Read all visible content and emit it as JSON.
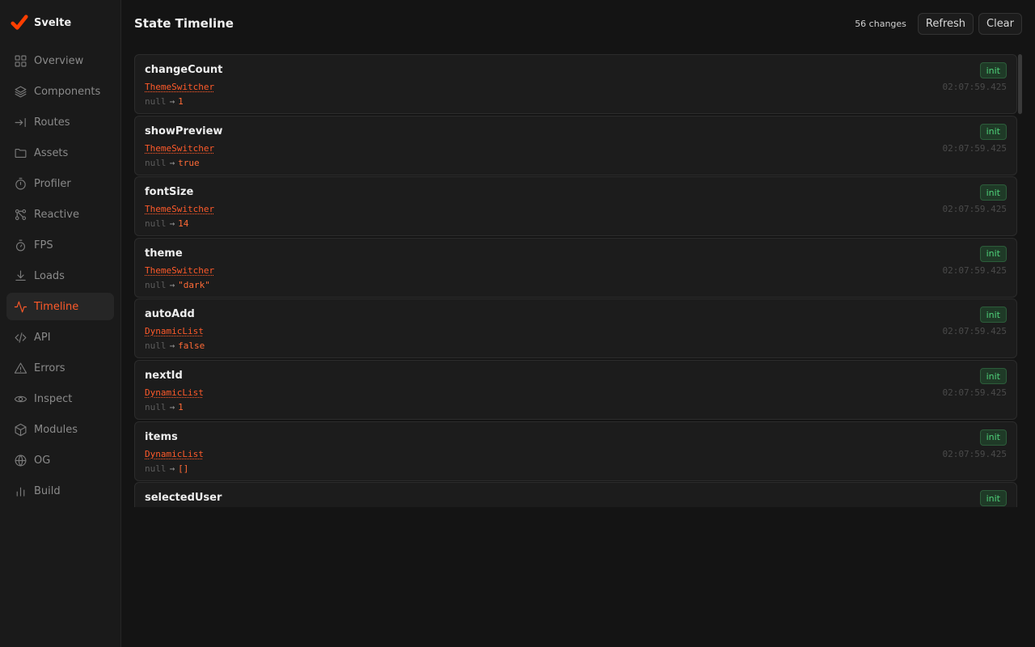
{
  "brand": {
    "name": "Svelte",
    "accent": "#ff3e00"
  },
  "nav": [
    {
      "label": "Overview",
      "icon": "grid-icon",
      "key": "overview"
    },
    {
      "label": "Components",
      "icon": "layers-icon",
      "key": "components"
    },
    {
      "label": "Routes",
      "icon": "route-arrow-icon",
      "key": "routes"
    },
    {
      "label": "Assets",
      "icon": "folder-icon",
      "key": "assets"
    },
    {
      "label": "Profiler",
      "icon": "stopwatch-icon",
      "key": "profiler"
    },
    {
      "label": "Reactive",
      "icon": "graph-nodes-icon",
      "key": "reactive"
    },
    {
      "label": "FPS",
      "icon": "timer-icon",
      "key": "fps"
    },
    {
      "label": "Loads",
      "icon": "download-icon",
      "key": "loads"
    },
    {
      "label": "Timeline",
      "icon": "activity-icon",
      "key": "timeline",
      "active": true
    },
    {
      "label": "API",
      "icon": "code-icon",
      "key": "api"
    },
    {
      "label": "Errors",
      "icon": "warning-icon",
      "key": "errors"
    },
    {
      "label": "Inspect",
      "icon": "eye-icon",
      "key": "inspect"
    },
    {
      "label": "Modules",
      "icon": "cube-icon",
      "key": "modules"
    },
    {
      "label": "OG",
      "icon": "globe-icon",
      "key": "og"
    },
    {
      "label": "Build",
      "icon": "bar-chart-icon",
      "key": "build"
    }
  ],
  "header": {
    "title": "State Timeline",
    "changes": "56 changes",
    "refresh_label": "Refresh",
    "clear_label": "Clear"
  },
  "entries": [
    {
      "name": "changeCount",
      "component": "ThemeSwitcher",
      "old": "null",
      "arrow": "→",
      "new": "1",
      "badge": "init",
      "time": "02:07:59.425"
    },
    {
      "name": "showPreview",
      "component": "ThemeSwitcher",
      "old": "null",
      "arrow": "→",
      "new": "true",
      "badge": "init",
      "time": "02:07:59.425"
    },
    {
      "name": "fontSize",
      "component": "ThemeSwitcher",
      "old": "null",
      "arrow": "→",
      "new": "14",
      "badge": "init",
      "time": "02:07:59.425"
    },
    {
      "name": "theme",
      "component": "ThemeSwitcher",
      "old": "null",
      "arrow": "→",
      "new": "\"dark\"",
      "badge": "init",
      "time": "02:07:59.425"
    },
    {
      "name": "autoAdd",
      "component": "DynamicList",
      "old": "null",
      "arrow": "→",
      "new": "false",
      "badge": "init",
      "time": "02:07:59.425"
    },
    {
      "name": "nextId",
      "component": "DynamicList",
      "old": "null",
      "arrow": "→",
      "new": "1",
      "badge": "init",
      "time": "02:07:59.425"
    },
    {
      "name": "items",
      "component": "DynamicList",
      "old": "null",
      "arrow": "→",
      "new": "[]",
      "badge": "init",
      "time": "02:07:59.425"
    },
    {
      "name": "selectedUser",
      "badge": "init"
    }
  ]
}
